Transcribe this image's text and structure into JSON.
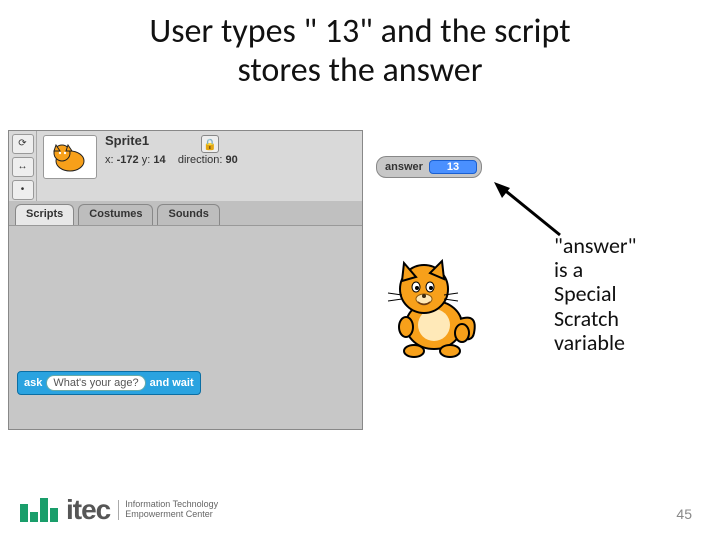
{
  "title_line1": "User types \" 13\" and the script",
  "title_line2": "stores the answer",
  "sprite": {
    "name": "Sprite1",
    "x_label": "x:",
    "x_val": "-172",
    "y_label": "y:",
    "y_val": "14",
    "dir_label": "direction:",
    "dir_val": "90"
  },
  "tabs": {
    "scripts": "Scripts",
    "costumes": "Costumes",
    "sounds": "Sounds"
  },
  "ask_block": {
    "ask": "ask",
    "placeholder": "What's your age?",
    "wait": "and wait"
  },
  "answer_watcher": {
    "label": "answer",
    "value": "13"
  },
  "annotation": {
    "l1": "\"answer\"",
    "l2": "is a",
    "l3": "Special",
    "l4": "Scratch",
    "l5": "variable"
  },
  "logo": {
    "brand": "itec",
    "sub1": "Information Technology",
    "sub2": "Empowerment Center"
  },
  "page_number": "45"
}
